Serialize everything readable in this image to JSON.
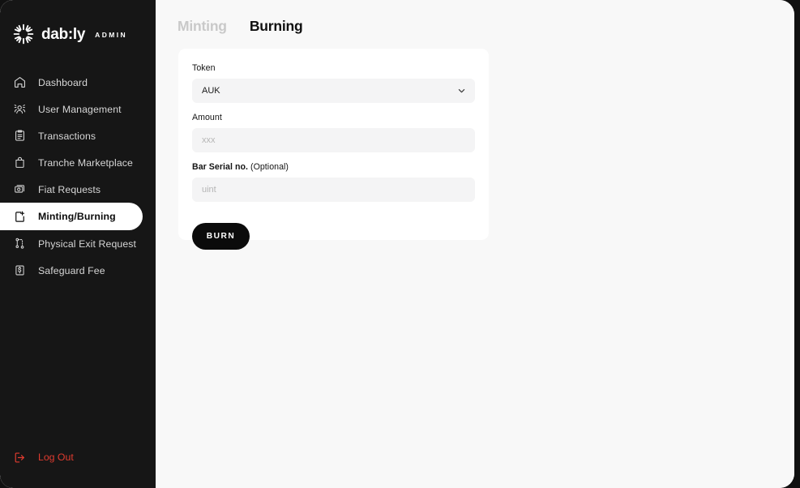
{
  "brand": {
    "logo_icon": "starburst-icon",
    "name": "dab:ly",
    "subtitle": "ADMIN"
  },
  "sidebar": {
    "items": [
      {
        "id": "dashboard",
        "label": "Dashboard",
        "icon": "home-icon",
        "active": false
      },
      {
        "id": "user-management",
        "label": "User Management",
        "icon": "users-icon",
        "active": false
      },
      {
        "id": "transactions",
        "label": "Transactions",
        "icon": "clipboard-icon",
        "active": false
      },
      {
        "id": "tranche-marketplace",
        "label": "Tranche Marketplace",
        "icon": "bag-icon",
        "active": false
      },
      {
        "id": "fiat-requests",
        "label": "Fiat Requests",
        "icon": "cards-money-icon",
        "active": false
      },
      {
        "id": "minting-burning",
        "label": "Minting/Burning",
        "icon": "file-plus-icon",
        "active": true
      },
      {
        "id": "physical-exit-request",
        "label": "Physical Exit Request",
        "icon": "flow-nodes-icon",
        "active": false
      },
      {
        "id": "safeguard-fee",
        "label": "Safeguard Fee",
        "icon": "s-box-icon",
        "active": false
      }
    ],
    "logout": {
      "label": "Log Out",
      "icon": "logout-icon",
      "color": "#e03b2f"
    }
  },
  "tabs": [
    {
      "id": "minting",
      "label": "Minting",
      "active": false
    },
    {
      "id": "burning",
      "label": "Burning",
      "active": true
    }
  ],
  "form": {
    "token": {
      "label": "Token",
      "value": "AUK",
      "chevron_icon": "chevron-down-icon"
    },
    "amount": {
      "label": "Amount",
      "value": "",
      "placeholder": "xxx"
    },
    "bar_serial": {
      "label": "Bar Serial no.",
      "label_optional": " (Optional)",
      "value": "",
      "placeholder": "uint"
    },
    "submit_label": "BURN"
  },
  "colors": {
    "sidebar_bg": "#161616",
    "page_bg": "#f8f8f8",
    "card_bg": "#ffffff",
    "input_bg": "#f4f4f5",
    "accent_dark": "#0b0b0b",
    "logout_red": "#e03b2f",
    "inactive_tab": "#c9c9c9"
  }
}
